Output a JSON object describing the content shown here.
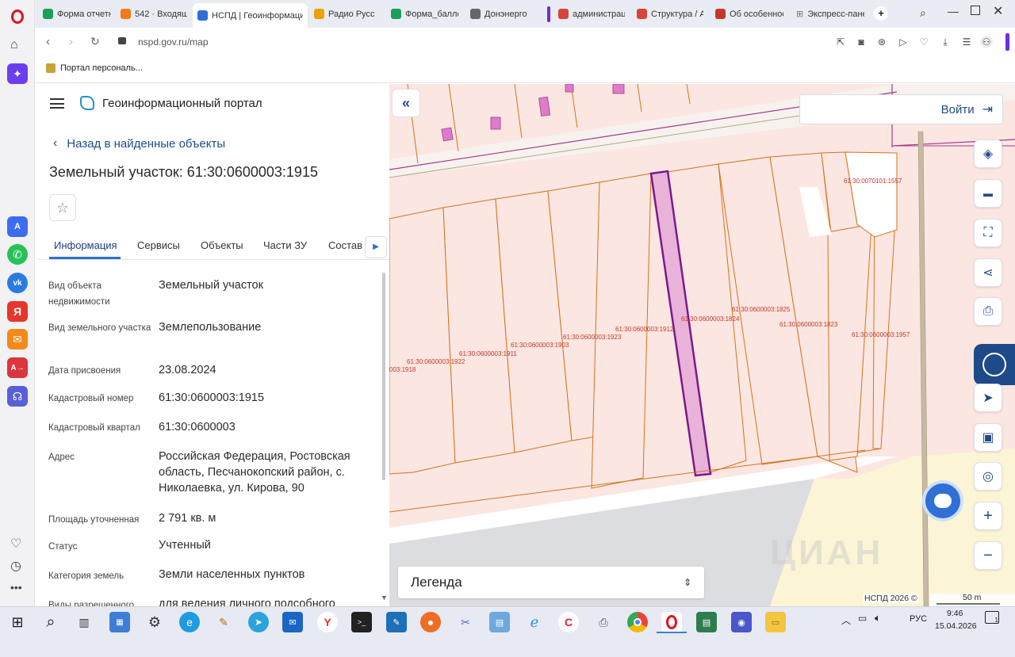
{
  "browser": {
    "tabs": [
      {
        "label": "Форма отчетн",
        "color": "#1e9e5a"
      },
      {
        "label": "542 · Входящи",
        "color": "#f27a1a"
      },
      {
        "label": "НСПД | Геоинформацис",
        "color": "#2f6fd6"
      },
      {
        "label": "Радио Русс",
        "color": "#e8a300"
      },
      {
        "label": "Форма_балло",
        "color": "#1e9e5a"
      },
      {
        "label": "Донэнерго",
        "color": "#666666"
      },
      {
        "label": "администраци",
        "color": "#d6453a"
      },
      {
        "label": "Структура / Ад",
        "color": "#d6453a"
      },
      {
        "label": "Об особенноc",
        "color": "#c0392b"
      },
      {
        "label": "Экспресс-пане",
        "color": "#888888"
      }
    ],
    "new_tab": "+",
    "url": "nspd.gov.ru/map",
    "bookmark": "Портал персональ..."
  },
  "portal": {
    "title": "Геоинформационный портал",
    "back_link": "Назад в найденные объекты",
    "object_title": "Земельный участок: 61:30:0600003:1915",
    "tabs": [
      "Информация",
      "Сервисы",
      "Объекты",
      "Части ЗУ",
      "Состав"
    ],
    "fields": [
      {
        "label": "Вид объекта недвижимости",
        "value": "Земельный участок"
      },
      {
        "label": "Вид земельного участка",
        "value": "Землепользование"
      },
      {
        "label": "Дата присвоения",
        "value": "23.08.2024"
      },
      {
        "label": "Кадастровый номер",
        "value": "61:30:0600003:1915"
      },
      {
        "label": "Кадастровый квартал",
        "value": "61:30:0600003"
      },
      {
        "label": "Адрес",
        "value": "Российская Федерация, Ростовская область, Песчанокопский район, с. Николаевка, ул. Кирова, 90"
      },
      {
        "label": "Площадь уточненная",
        "value": "2 791 кв. м"
      },
      {
        "label": "Статус",
        "value": "Учтенный"
      },
      {
        "label": "Категория земель",
        "value": "Земли населенных пунктов"
      },
      {
        "label": "Виды разрешенного использования",
        "value": "для ведения личного подсобного хозяйства"
      }
    ]
  },
  "map": {
    "login": "Войти",
    "legend": "Легенда",
    "copyright": "НСПД 2026 ©",
    "scale": "50 m",
    "watermark": "ЦИАН",
    "parcel_labels": [
      "003:1918",
      "61:30:0600003:1922",
      "61:30:0600003:1911",
      "61:30:0600003:1903",
      "61:30:0600003:1923",
      "61:30:0600003:1912",
      "61:30:0600003:1824",
      "61:30:0600003:1825",
      "61:30:0600003:1823",
      "61:30:0600003:1957",
      "61:30:0070101:1557"
    ]
  },
  "taskbar": {
    "lang": "РУС",
    "time": "9:46",
    "date": "15.04.2026"
  }
}
